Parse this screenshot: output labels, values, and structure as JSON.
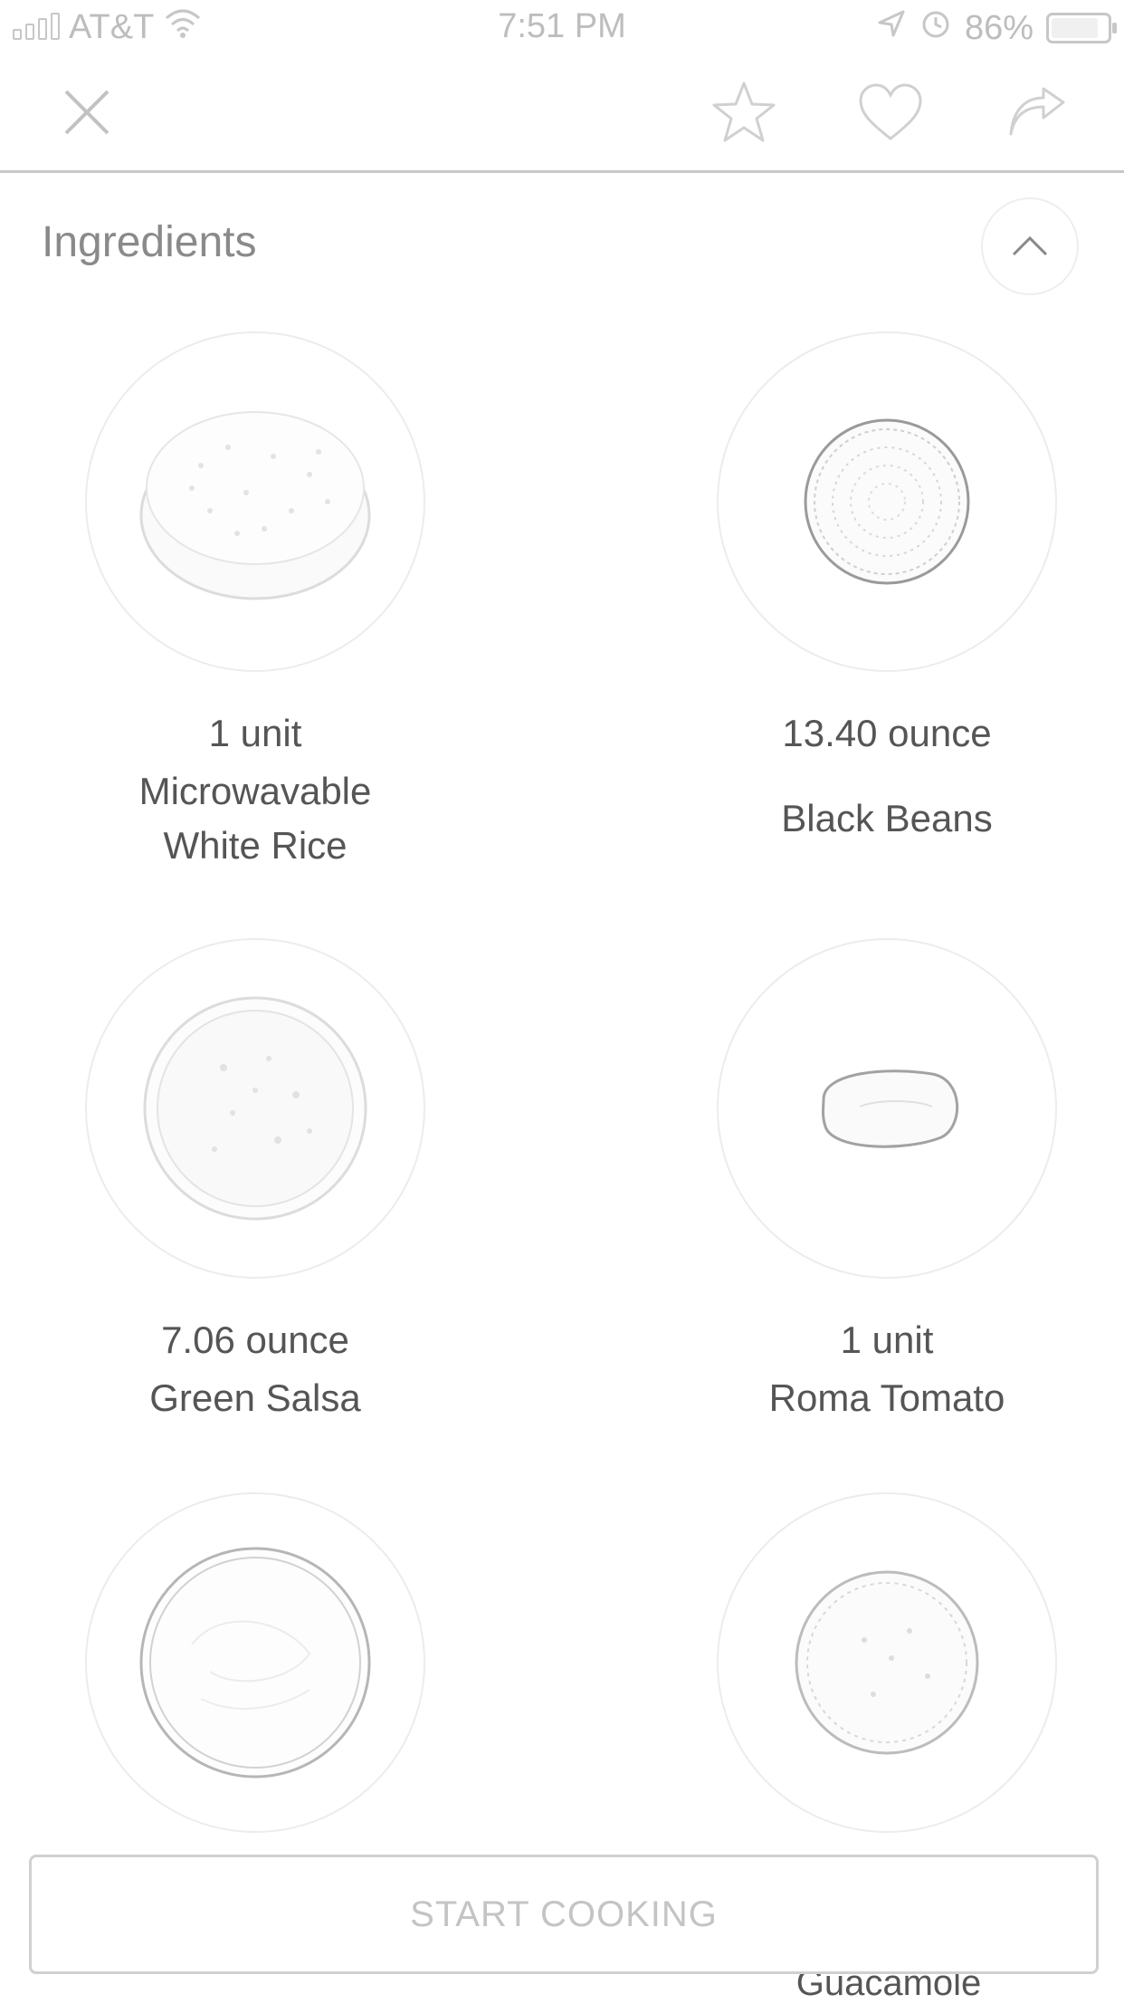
{
  "status_bar": {
    "carrier": "AT&T",
    "time": "7:51 PM",
    "battery": "86%"
  },
  "nav": {
    "close_icon": "close-icon",
    "favorite_icon": "star-icon",
    "like_icon": "heart-icon",
    "share_icon": "share-icon"
  },
  "ingredients": {
    "title": "Ingredients",
    "items": [
      {
        "quantity": "1 unit",
        "name": "Microwavable White Rice"
      },
      {
        "quantity": "13.40 ounce",
        "name": "Black Beans"
      },
      {
        "quantity": "7.06 ounce",
        "name": "Green Salsa"
      },
      {
        "quantity": "1 unit",
        "name": "Roma Tomato"
      },
      {
        "quantity": "",
        "name": ""
      },
      {
        "quantity": "",
        "name": "Guacamole"
      }
    ]
  },
  "start_button": {
    "label": "START COOKING"
  }
}
